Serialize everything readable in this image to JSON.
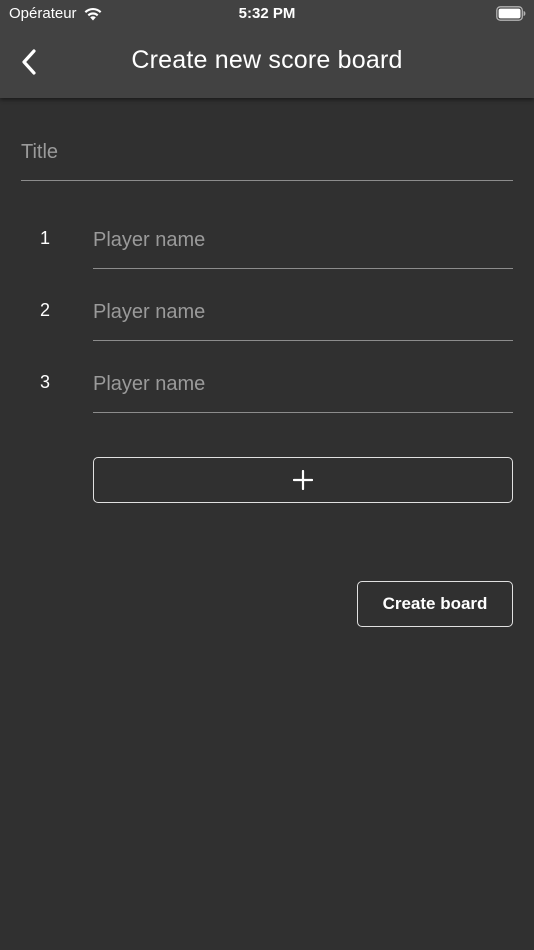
{
  "status_bar": {
    "carrier": "Opérateur",
    "time": "5:32 PM",
    "wifi_icon": "wifi-icon",
    "battery_icon": "battery-full-icon"
  },
  "app_bar": {
    "title": "Create new score board",
    "back_icon": "chevron-left-icon"
  },
  "form": {
    "title_placeholder": "Title",
    "title_value": "",
    "players": [
      {
        "number": "1",
        "placeholder": "Player name",
        "value": ""
      },
      {
        "number": "2",
        "placeholder": "Player name",
        "value": ""
      },
      {
        "number": "3",
        "placeholder": "Player name",
        "value": ""
      }
    ],
    "add_player_icon": "plus-icon",
    "create_button_label": "Create board"
  },
  "colors": {
    "background": "#303030",
    "app_bar": "#424242",
    "underline": "#8c8c8c",
    "placeholder": "#9a9a9a",
    "text": "#ffffff"
  }
}
